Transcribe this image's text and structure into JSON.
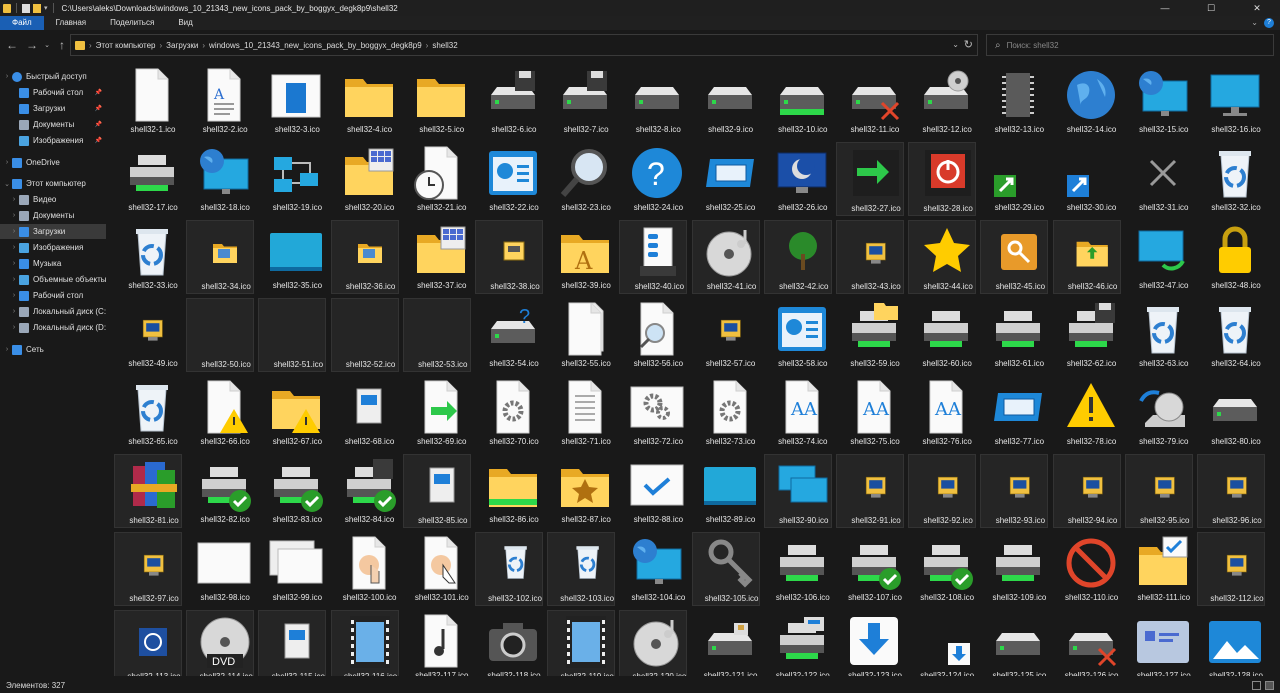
{
  "window": {
    "path": "C:\\Users\\aleks\\Downloads\\windows_10_21343_new_icons_pack_by_boggyx_degk8p9\\shell32",
    "controls": [
      "—",
      "☐",
      "✕"
    ]
  },
  "ribbon": {
    "tabs": [
      "Файл",
      "Главная",
      "Поделиться",
      "Вид"
    ],
    "active": 0
  },
  "address": {
    "crumbs": [
      "Этот компьютер",
      "Загрузки",
      "windows_10_21343_new_icons_pack_by_boggyx_degk8p9",
      "shell32"
    ]
  },
  "search": {
    "placeholder": "Поиск: shell32"
  },
  "sidebar": {
    "items": [
      {
        "label": "Быстрый доступ",
        "icon": "star-icon",
        "level": 0,
        "exp": "›",
        "pin": false
      },
      {
        "label": "Рабочий стол",
        "icon": "desktop-icon",
        "level": 1,
        "exp": "",
        "pin": true
      },
      {
        "label": "Загрузки",
        "icon": "download-icon",
        "level": 1,
        "exp": "",
        "pin": true
      },
      {
        "label": "Документы",
        "icon": "documents-icon",
        "level": 1,
        "exp": "",
        "pin": true
      },
      {
        "label": "Изображения",
        "icon": "pictures-icon",
        "level": 1,
        "exp": "",
        "pin": true
      },
      {
        "label": "",
        "icon": "",
        "level": 0,
        "exp": "",
        "pin": false
      },
      {
        "label": "OneDrive",
        "icon": "cloud-icon",
        "level": 0,
        "exp": "›",
        "pin": false
      },
      {
        "label": "",
        "icon": "",
        "level": 0,
        "exp": "",
        "pin": false
      },
      {
        "label": "Этот компьютер",
        "icon": "computer-icon",
        "level": 0,
        "exp": "⌄",
        "pin": false
      },
      {
        "label": "Видео",
        "icon": "video-icon",
        "level": 1,
        "exp": "›",
        "pin": false
      },
      {
        "label": "Документы",
        "icon": "documents-icon",
        "level": 1,
        "exp": "›",
        "pin": false
      },
      {
        "label": "Загрузки",
        "icon": "download-icon",
        "level": 1,
        "exp": "›",
        "pin": false,
        "selected": true
      },
      {
        "label": "Изображения",
        "icon": "pictures-icon",
        "level": 1,
        "exp": "›",
        "pin": false
      },
      {
        "label": "Музыка",
        "icon": "music-icon",
        "level": 1,
        "exp": "›",
        "pin": false
      },
      {
        "label": "Объемные объекты",
        "icon": "objects3d-icon",
        "level": 1,
        "exp": "›",
        "pin": false
      },
      {
        "label": "Рабочий стол",
        "icon": "desktop-icon",
        "level": 1,
        "exp": "›",
        "pin": false
      },
      {
        "label": "Локальный диск (C:)",
        "icon": "drive-icon",
        "level": 1,
        "exp": "›",
        "pin": false
      },
      {
        "label": "Локальный диск (D:)",
        "icon": "drive-icon",
        "level": 1,
        "exp": "›",
        "pin": false
      },
      {
        "label": "",
        "icon": "",
        "level": 0,
        "exp": "",
        "pin": false
      },
      {
        "label": "Сеть",
        "icon": "network-icon",
        "level": 0,
        "exp": "›",
        "pin": false
      }
    ]
  },
  "files": {
    "prefix": "shell32-",
    "ext": ".ico",
    "icons": [
      "blank",
      "doc",
      "doc-blue",
      "folder",
      "folder",
      "drive-floppy",
      "drive-floppy",
      "drive",
      "drive",
      "drive-green",
      "drive-x",
      "drive-cd",
      "chip",
      "globe",
      "monitor-globe",
      "monitor",
      "printer",
      "monitor-globe",
      "network",
      "folder-grid",
      "clock-doc",
      "blue-panel",
      "magnifier",
      "help",
      "blue-window",
      "monitor-moon",
      "green-arrow",
      "power-red",
      "shortcut-green",
      "shortcut-blue",
      "x-grey",
      "recycle",
      "recycle",
      "small-folder",
      "teal-card",
      "small-folder",
      "folder-grid",
      "small-drive",
      "folder-font",
      "control-panel",
      "cd-music",
      "tree",
      "small-pc",
      "star",
      "key-box",
      "folder-up",
      "monitor-sync",
      "lock",
      "small-pc",
      "empty",
      "empty",
      "empty",
      "empty",
      "drive-help",
      "doc-multi",
      "doc-search",
      "small-pc",
      "blue-panel",
      "printer-folder",
      "printer",
      "printer",
      "printer-floppy",
      "recycle",
      "recycle",
      "recycle",
      "doc-warning",
      "folder-warning",
      "small-doc",
      "doc-arrow",
      "doc-gear",
      "doc-lines",
      "gear-window",
      "doc-gear",
      "doc-font",
      "doc-font",
      "doc-font",
      "blue-window",
      "warning",
      "cd-arrow",
      "drive",
      "winrar",
      "printer-check",
      "printer-check",
      "printer-floppy-check",
      "small-doc",
      "folder-drive",
      "folder-star",
      "check-window",
      "teal-card",
      "monitors",
      "small-pc",
      "small-pc",
      "small-pc",
      "small-pc",
      "small-pc",
      "small-pc",
      "small-pc",
      "white-window",
      "white-windows",
      "doc-hand",
      "doc-cursor",
      "small-recycle",
      "small-recycle",
      "monitor-globe",
      "keys",
      "printer",
      "printer-check",
      "printer-check",
      "printer",
      "no-sign",
      "folder-check",
      "small-pc",
      "power-small",
      "dvd",
      "small-doc",
      "film-doc",
      "music-doc",
      "camera",
      "film-doc",
      "cd-music",
      "drive-sd",
      "printer-drive",
      "download-blue",
      "small-download",
      "drive",
      "drive-x",
      "card-folder",
      "picture-folder"
    ]
  },
  "colors": {
    "bg": "#191919",
    "accent": "#1a5fb4"
  },
  "status": {
    "count": "Элементов: 327"
  }
}
